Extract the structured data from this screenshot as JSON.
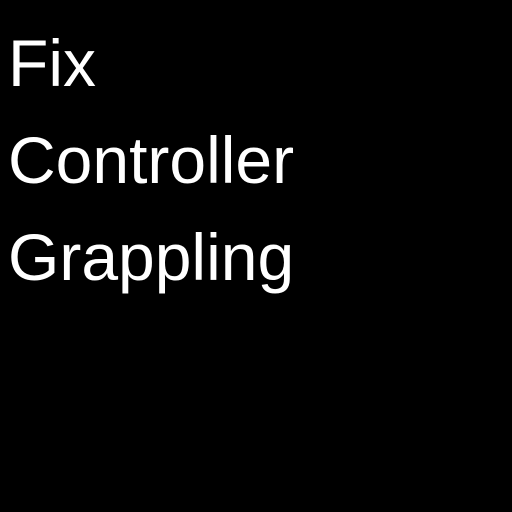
{
  "text": {
    "lines": [
      "Fix",
      "Controller",
      "Grappling"
    ]
  },
  "colors": {
    "background": "#000000",
    "text": "#ffffff"
  }
}
